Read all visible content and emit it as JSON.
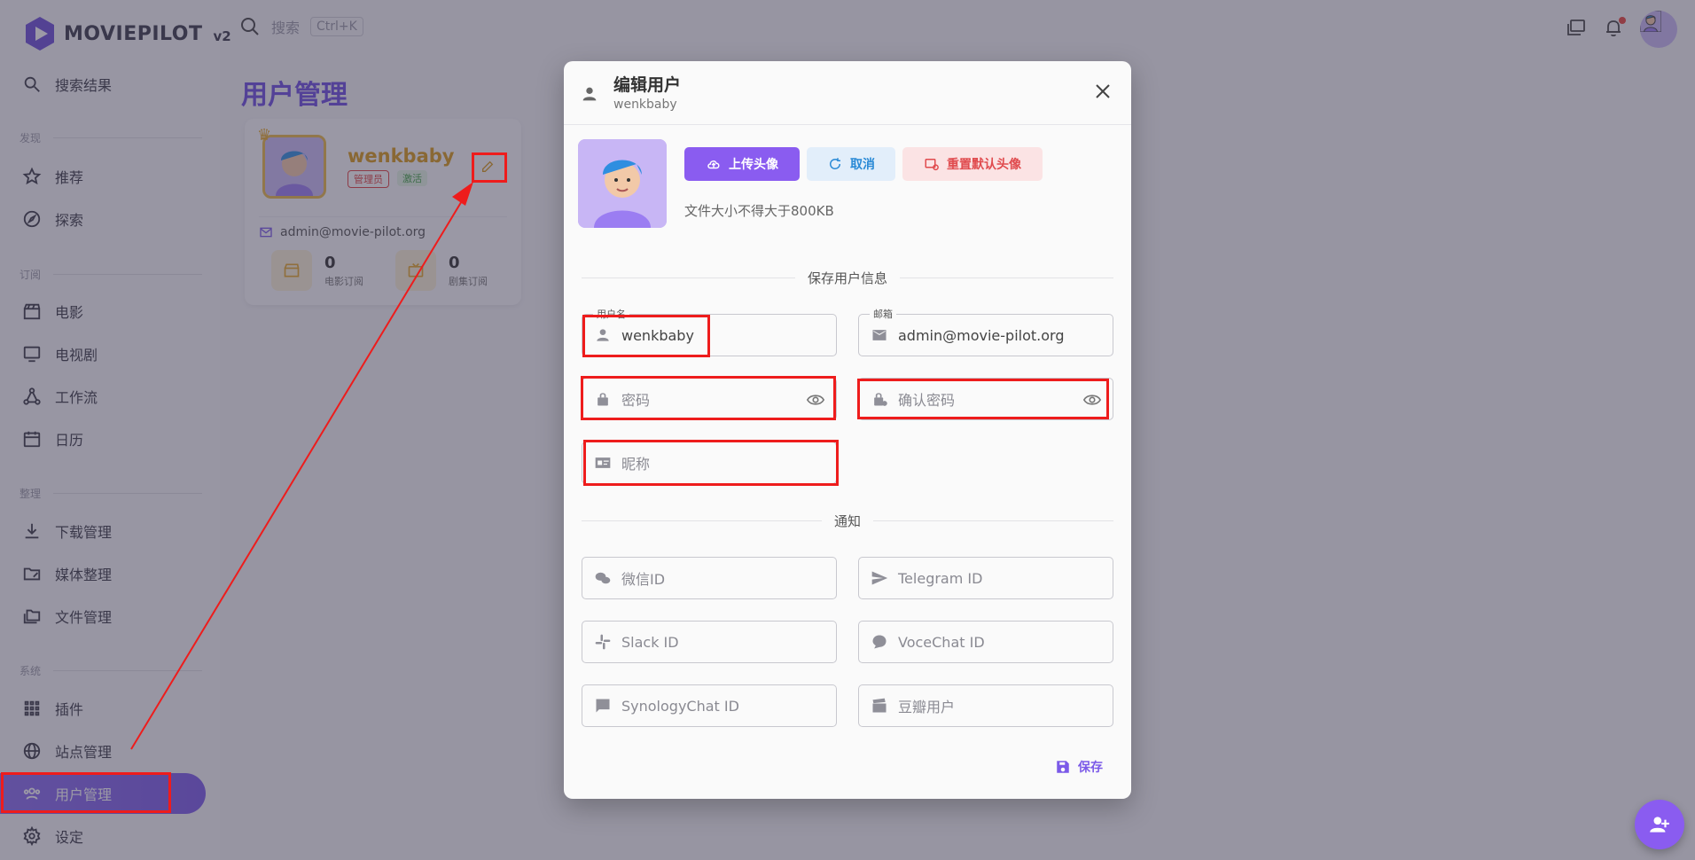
{
  "app": {
    "logo_text": "MOVIEPILOT",
    "version": "v2"
  },
  "sidebar": {
    "search_result": "搜索结果",
    "sections": {
      "discover": "发现",
      "subscribe": "订阅",
      "organize": "整理",
      "system": "系统"
    },
    "items": {
      "recommend": "推荐",
      "explore": "探索",
      "movie": "电影",
      "tv": "电视剧",
      "workflow": "工作流",
      "calendar": "日历",
      "download": "下载管理",
      "media": "媒体整理",
      "files": "文件管理",
      "plugins": "插件",
      "sites": "站点管理",
      "users": "用户管理",
      "settings": "设定"
    }
  },
  "topbar": {
    "search_placeholder": "搜索",
    "shortcut": "Ctrl+K"
  },
  "page": {
    "title": "用户管理",
    "card": {
      "username": "wenkbaby",
      "role_badge": "管理员",
      "status_badge": "激活",
      "email": "admin@movie-pilot.org",
      "movie_count": "0",
      "movie_label": "电影订阅",
      "tv_count": "0",
      "tv_label": "剧集订阅"
    }
  },
  "dialog": {
    "title": "编辑用户",
    "subtitle": "wenkbaby",
    "upload_label": "上传头像",
    "cancel_label": "取消",
    "reset_label": "重置默认头像",
    "size_hint": "文件大小不得大于800KB",
    "section_user": "保存用户信息",
    "section_notify": "通知",
    "fields": {
      "username_label": "用户名",
      "username_value": "wenkbaby",
      "email_label": "邮箱",
      "email_value": "admin@movie-pilot.org",
      "password_ph": "密码",
      "confirm_ph": "确认密码",
      "nickname_ph": "昵称",
      "wechat_ph": "微信ID",
      "telegram_ph": "Telegram ID",
      "slack_ph": "Slack ID",
      "vocechat_ph": "VoceChat ID",
      "synology_ph": "SynologyChat ID",
      "douban_ph": "豆瓣用户"
    },
    "save_label": "保存"
  },
  "colors": {
    "accent": "#8a5cf0",
    "highlight": "#ee1c1c",
    "gold": "#d99a1b"
  }
}
